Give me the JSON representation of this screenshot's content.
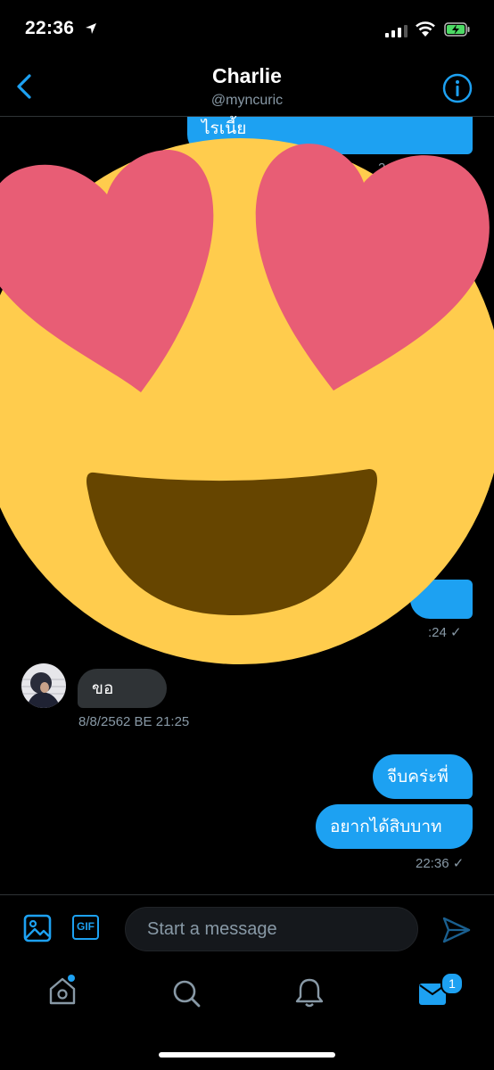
{
  "status_bar": {
    "time": "22:36"
  },
  "header": {
    "title": "Charlie",
    "handle": "@myncuric"
  },
  "messages": [
    {
      "text": "ไรเนี้ย"
    },
    {
      "timestamp": "2 BE 20:28 ✓"
    },
    {
      "timestamp": ":24 ✓"
    },
    {
      "text": "ขอ"
    },
    {
      "timestamp": "8/8/2562 BE 21:25"
    },
    {
      "text": "จีบคร่ะพี่"
    },
    {
      "text": "อยากได้สิบบาท"
    },
    {
      "timestamp": "22:36 ✓"
    }
  ],
  "composer": {
    "placeholder": "Start a message",
    "gif_label": "GIF"
  },
  "tabbar": {
    "messages_badge": "1"
  },
  "colors": {
    "accent": "#1da1f2",
    "background": "#000000",
    "heart": "#e85d75",
    "face": "#ffcc4d",
    "mouth": "#664500"
  },
  "overlay": {
    "emoji": "smiling-face-with-heart-eyes"
  }
}
